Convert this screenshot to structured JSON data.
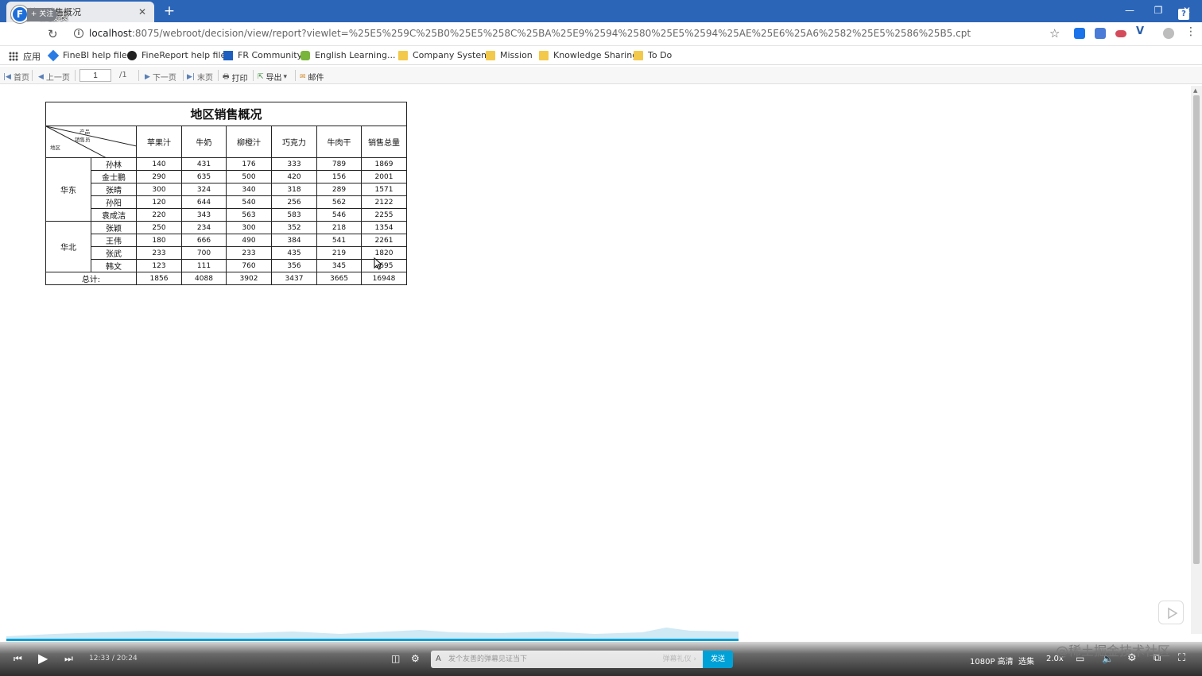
{
  "browser": {
    "tab_title": "地区销售概况",
    "video_title": "4.第一张报表",
    "follow_label": "+ 关注",
    "up_letter": "F",
    "url_host": "localhost",
    "url_rest": ":8075/webroot/decision/view/report?viewlet=%25E5%259C%25B0%25E5%258C%25BA%25E9%2594%2580%25E5%2594%25AE%25E6%25A6%2582%25E5%2586%25B5.cpt",
    "help_badge": "?"
  },
  "bookmarks": [
    {
      "label": "应用",
      "icon": "apps-grid-icon"
    },
    {
      "label": "FineBI help file",
      "icon": "finebi-icon"
    },
    {
      "label": "FineReport help file",
      "icon": "finereport-icon"
    },
    {
      "label": "FR Community",
      "icon": "fr-community-icon"
    },
    {
      "label": "English Learning...",
      "icon": "owl-icon"
    },
    {
      "label": "Company System",
      "icon": "folder-icon"
    },
    {
      "label": "Mission",
      "icon": "folder-icon"
    },
    {
      "label": "Knowledge Sharing",
      "icon": "folder-icon"
    },
    {
      "label": "To Do",
      "icon": "folder-icon"
    }
  ],
  "toolbar": {
    "first": "首页",
    "prev": "上一页",
    "page_value": "1",
    "page_total": "/1",
    "next": "下一页",
    "last": "末页",
    "print": "打印",
    "export": "导出",
    "mail": "邮件"
  },
  "report": {
    "title": "地区销售概况",
    "corner": {
      "product": "产品",
      "salesperson": "销售员",
      "region": "地区"
    },
    "columns": [
      "苹果汁",
      "牛奶",
      "柳橙汁",
      "巧克力",
      "牛肉干",
      "销售总量"
    ],
    "groups": [
      {
        "region": "华东",
        "rows": [
          {
            "name": "孙林",
            "values": [
              "140",
              "431",
              "176",
              "333",
              "789",
              "1869"
            ]
          },
          {
            "name": "金士鹏",
            "values": [
              "290",
              "635",
              "500",
              "420",
              "156",
              "2001"
            ]
          },
          {
            "name": "张晴",
            "values": [
              "300",
              "324",
              "340",
              "318",
              "289",
              "1571"
            ]
          },
          {
            "name": "孙阳",
            "values": [
              "120",
              "644",
              "540",
              "256",
              "562",
              "2122"
            ]
          },
          {
            "name": "袁成洁",
            "values": [
              "220",
              "343",
              "563",
              "583",
              "546",
              "2255"
            ]
          }
        ]
      },
      {
        "region": "华北",
        "rows": [
          {
            "name": "张颖",
            "values": [
              "250",
              "234",
              "300",
              "352",
              "218",
              "1354"
            ]
          },
          {
            "name": "王伟",
            "values": [
              "180",
              "666",
              "490",
              "384",
              "541",
              "2261"
            ]
          },
          {
            "name": "张武",
            "values": [
              "233",
              "700",
              "233",
              "435",
              "219",
              "1820"
            ]
          },
          {
            "name": "韩文",
            "values": [
              "123",
              "111",
              "760",
              "356",
              "345",
              "1695"
            ]
          }
        ]
      }
    ],
    "total_label": "总计:",
    "totals": [
      "1856",
      "4088",
      "3902",
      "3437",
      "3665",
      "16948"
    ]
  },
  "player": {
    "time_current": "12:33",
    "time_sep": "/",
    "time_total": "20:24",
    "quality": "1080P 高清",
    "episodes": "选集",
    "speed": "2.0x",
    "send": "发送",
    "danmaku_placeholder": "发个友善的弹幕见证当下",
    "danmaku_etiquette": "弹幕礼仪 ›",
    "watermark": "@稀土掘金技术社区",
    "accent": "#00a1d6"
  }
}
